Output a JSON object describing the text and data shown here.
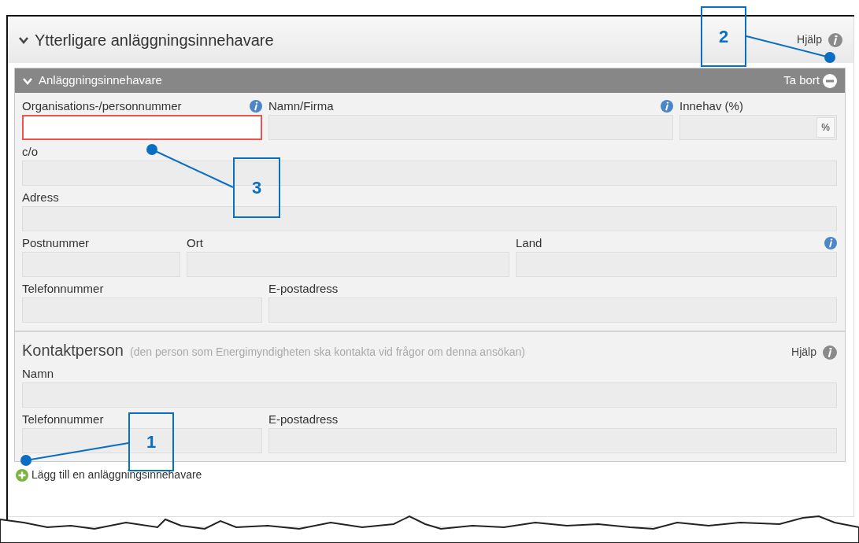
{
  "section": {
    "title": "Ytterligare anläggningsinnehavare",
    "expanded": true,
    "help": "Hjälp"
  },
  "owner": {
    "title": "Anläggningsinnehavare",
    "expanded": true,
    "remove": "Ta bort",
    "rows": [
      [
        {
          "label": "Organisations-/personnummer",
          "info": true,
          "invalid": true
        },
        {
          "label": "Namn/Firma",
          "info": true,
          "invalid": false
        },
        {
          "label": "Innehav (%)",
          "info": false,
          "invalid": false,
          "addon": "%"
        }
      ],
      [
        {
          "label": "c/o",
          "info": false,
          "invalid": false
        }
      ],
      [
        {
          "label": "Adress",
          "info": false,
          "invalid": false
        }
      ],
      [
        {
          "label": "Postnummer",
          "info": false,
          "invalid": false
        },
        {
          "label": "Ort",
          "info": false,
          "invalid": false
        },
        {
          "label": "Land",
          "info": true,
          "invalid": false
        }
      ],
      [
        {
          "label": "Telefonnummer",
          "info": false,
          "invalid": false
        },
        {
          "label": "E-postadress",
          "info": false,
          "invalid": false
        }
      ]
    ]
  },
  "contact": {
    "title": "Kontaktperson",
    "note": "(den person som Energimyndigheten ska kontakta vid frågor om denna ansökan)",
    "help": "Hjälp",
    "rows": [
      [
        {
          "label": "Namn",
          "info": false,
          "invalid": false
        }
      ],
      [
        {
          "label": "Telefonnummer",
          "info": false,
          "invalid": false
        },
        {
          "label": "E-postadress",
          "info": false,
          "invalid": false
        }
      ]
    ]
  },
  "add_link": "Lägg till en anläggningsinnehavare",
  "callouts": [
    {
      "number": "2"
    },
    {
      "number": "3"
    },
    {
      "number": "1"
    }
  ]
}
